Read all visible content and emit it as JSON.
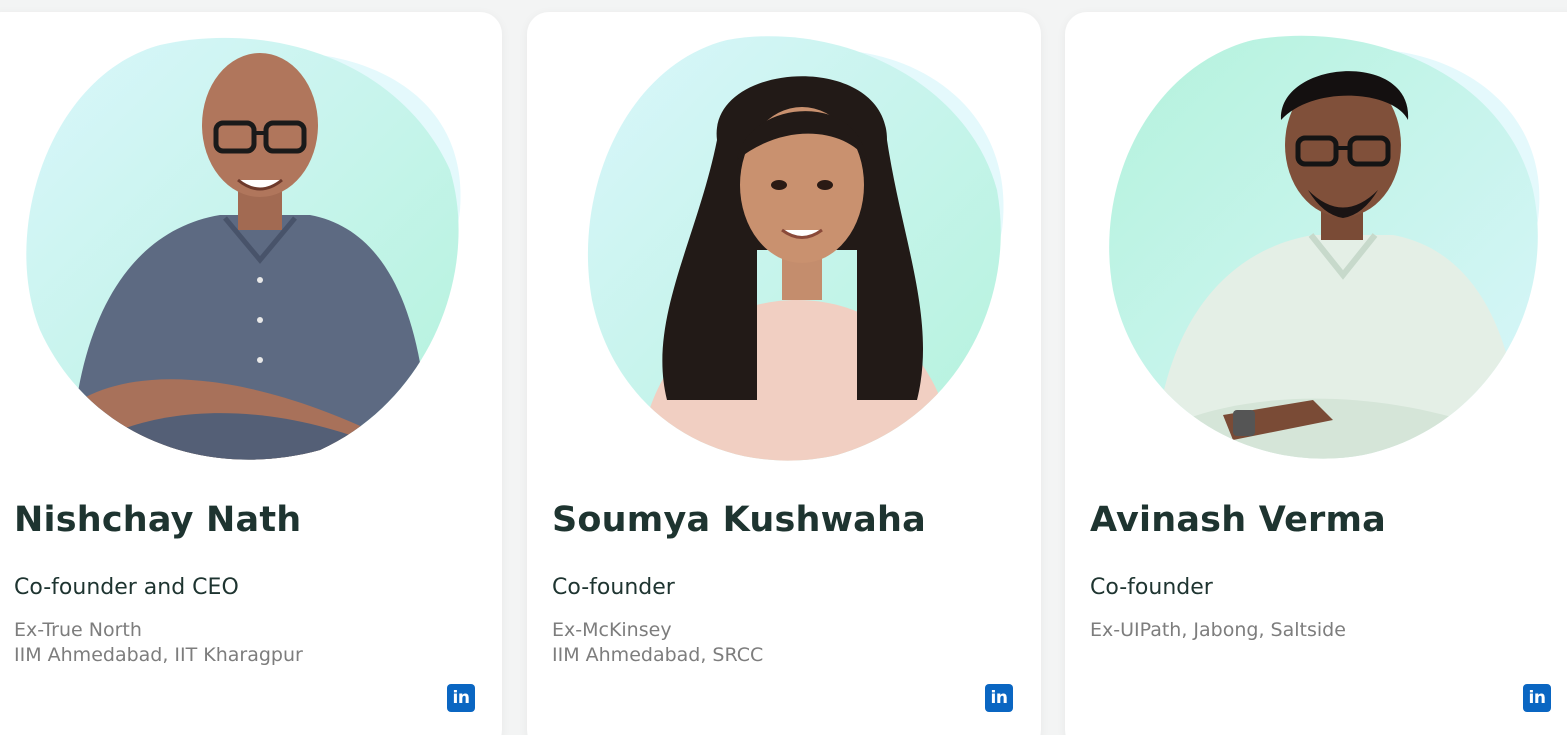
{
  "team": [
    {
      "name": "Nishchay Nath",
      "role": "Co-founder and CEO",
      "background": [
        "Ex-True North",
        "IIM Ahmedabad, IIT Kharagpur"
      ],
      "social_icon": "linkedin-icon",
      "social_label": "in"
    },
    {
      "name": "Soumya Kushwaha",
      "role": "Co-founder",
      "background": [
        "Ex-McKinsey",
        "IIM Ahmedabad, SRCC"
      ],
      "social_icon": "linkedin-icon",
      "social_label": "in"
    },
    {
      "name": "Avinash Verma",
      "role": "Co-founder",
      "background": [
        "Ex-UIPath, Jabong, Saltside"
      ],
      "social_icon": "linkedin-icon",
      "social_label": "in"
    }
  ],
  "colors": {
    "blob_teal": "#b6f3df",
    "blob_blue": "#d8f5fb",
    "heading": "#1e3430",
    "muted": "#7d7d7d",
    "linkedin": "#0a66c2",
    "card_bg": "#ffffff",
    "page_bg": "#f3f4f4"
  }
}
